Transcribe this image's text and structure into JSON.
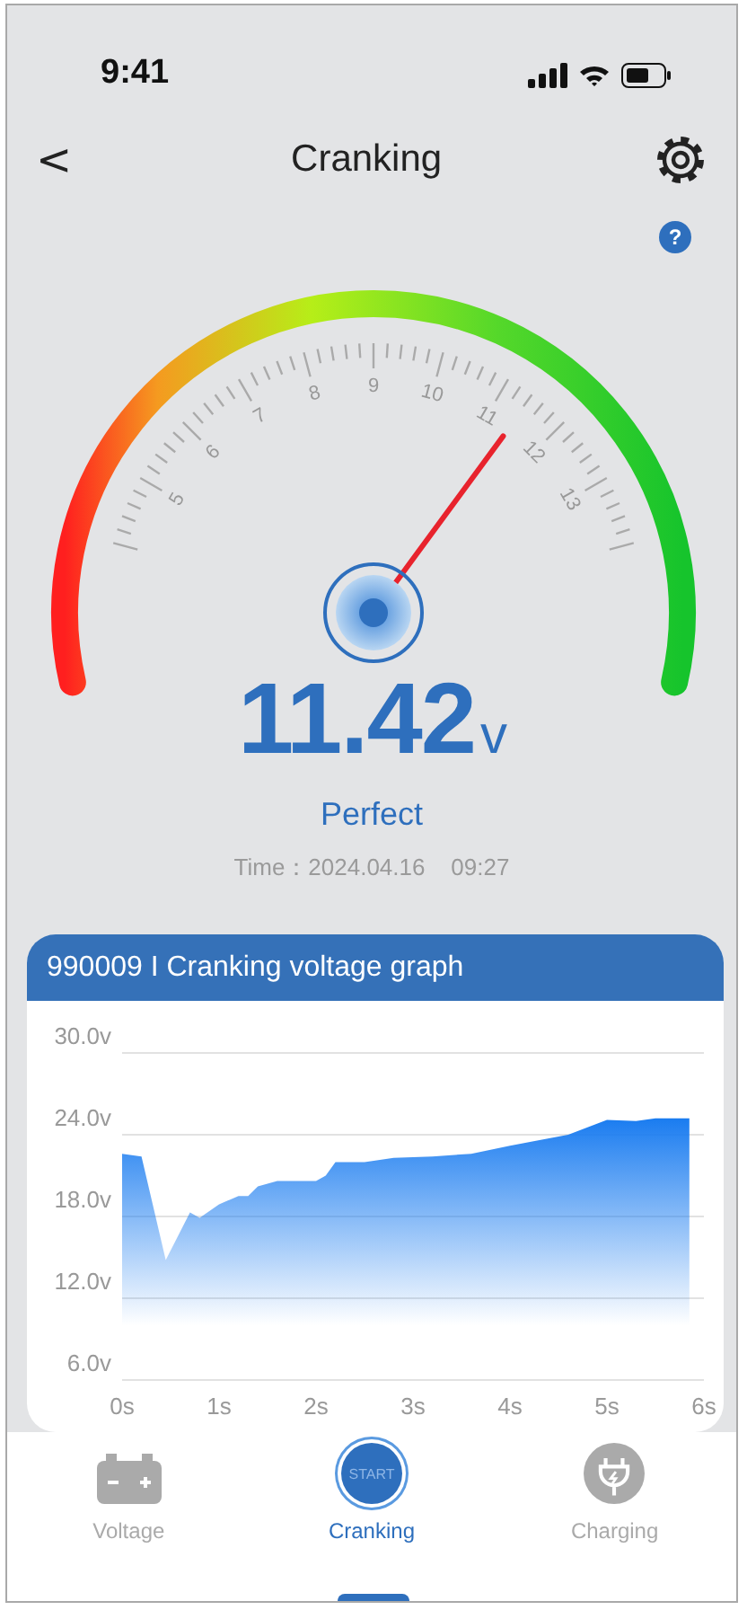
{
  "status_bar": {
    "time": "9:41"
  },
  "header": {
    "back": "<",
    "title": "Cranking"
  },
  "help": "?",
  "gauge": {
    "scale_labels": [
      "5",
      "6",
      "7",
      "8",
      "9",
      "10",
      "11",
      "12",
      "13"
    ]
  },
  "reading": {
    "value": "11.42",
    "unit": "v",
    "status": "Perfect",
    "time": "Time：2024.04.16    09:27"
  },
  "card": {
    "title": "990009 I Cranking voltage graph",
    "chart_data": {
      "type": "area",
      "x": [
        0,
        0.2,
        0.45,
        0.7,
        0.8,
        1.0,
        1.2,
        1.3,
        1.4,
        1.6,
        2.0,
        2.1,
        2.2,
        2.5,
        2.8,
        3.2,
        3.6,
        4.0,
        4.6,
        5.0,
        5.3,
        5.5,
        5.85
      ],
      "grid": true,
      "series": [
        {
          "color": "#1a7cf0",
          "values": [
            22.6,
            22.4,
            14.8,
            18.3,
            17.9,
            18.9,
            19.5,
            19.5,
            20.2,
            20.6,
            20.6,
            21.0,
            22.0,
            22.0,
            22.3,
            22.4,
            22.6,
            23.2,
            24.0,
            25.1,
            25.0,
            25.2,
            25.2
          ]
        }
      ],
      "xlim": [
        0,
        6
      ],
      "ylim": [
        6,
        30
      ],
      "xticks": [
        {
          "value": 0,
          "label": "0s"
        },
        {
          "value": 1,
          "label": "1s"
        },
        {
          "value": 2,
          "label": "2s"
        },
        {
          "value": 3,
          "label": "3s"
        },
        {
          "value": 4,
          "label": "4s"
        },
        {
          "value": 5,
          "label": "5s"
        },
        {
          "value": 6,
          "label": "6s"
        }
      ],
      "yticks": [
        {
          "value": 30,
          "label": "30.0v"
        },
        {
          "value": 24,
          "label": "24.0v"
        },
        {
          "value": 18,
          "label": "18.0v"
        },
        {
          "value": 12,
          "label": "12.0v"
        },
        {
          "value": 6,
          "label": "6.0v"
        }
      ]
    }
  },
  "tabs": [
    {
      "kind": "battery",
      "label": "Voltage",
      "selected": false
    },
    {
      "kind": "start",
      "label": "Cranking",
      "icon_text": "START",
      "selected": true
    },
    {
      "kind": "plug",
      "label": "Charging",
      "selected": false
    }
  ]
}
